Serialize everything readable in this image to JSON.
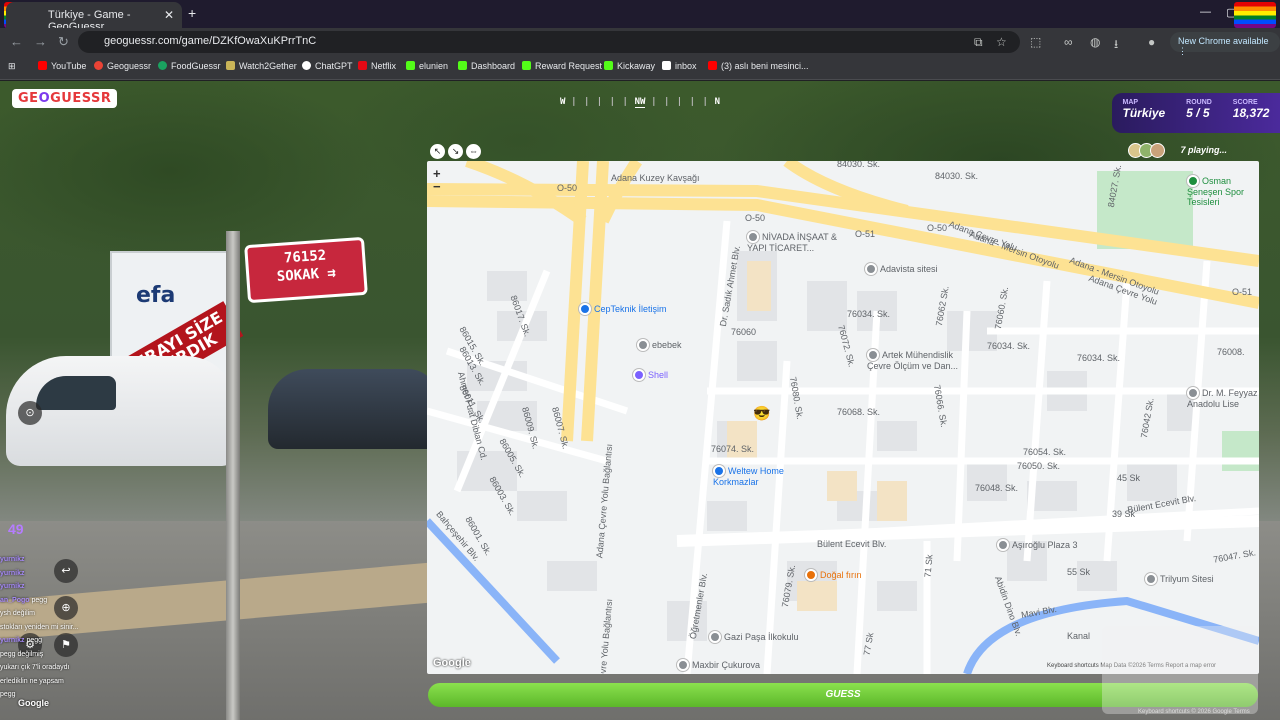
{
  "browser": {
    "tab_title": "Türkiye - Game - GeoGuessr",
    "url": "geoguessr.com/game/DZKfOwaXuKPrrTnC",
    "new_chrome": "New Chrome available",
    "bookmarks": [
      "YouTube",
      "Geoguessr",
      "FoodGuessr",
      "Watch2Gether",
      "ChatGPT",
      "Netflix",
      "elunien",
      "Dashboard",
      "Reward Request",
      "Kickaway",
      "inbox",
      "(3) aslı beni mesinci..."
    ],
    "bookmark_colors": [
      "#ff0000",
      "#ea4335",
      "#1aa260",
      "#c9b458",
      "#ffffff",
      "#e50914",
      "#53fc18",
      "#53fc18",
      "#53fc18",
      "#53fc18",
      "#ffffff",
      "#ff0000"
    ]
  },
  "game": {
    "logo_a": "GE",
    "logo_b": "O",
    "logo_c": "GUESSR",
    "compass_w": "W",
    "compass_nw": "NW",
    "compass_n": "N",
    "hud": {
      "map_label": "MAP",
      "map_value": "Türkiye",
      "round_label": "ROUND",
      "round_value": "5 / 5",
      "score_label": "SCORE",
      "score_value": "18,372"
    },
    "playing": "7 playing...",
    "guess_button": "GUESS",
    "chat_count": "49"
  },
  "scene": {
    "sign_line1": "76152",
    "sign_line2": "SOKAK ⇉",
    "billboard_logo": "efa",
    "banner": "BURAYI SİZE YIKIRDIK"
  },
  "map": {
    "zoom_in": "+",
    "zoom_out": "−",
    "google": "Google",
    "footer": "Keyboard shortcuts   Map Data ©2026   Terms   Report a map error",
    "streets": [
      "Adana Kuzey Kavşağı",
      "84030. Sk.",
      "84030. Sk.",
      "O-50",
      "O-50",
      "O-51",
      "O-50",
      "O-51",
      "Adana Çevre Yolu",
      "Adana - Mersin Otoyolu",
      "Adana - Mersin Otoyolu",
      "Adana Çevre Yolu",
      "86017. Sk.",
      "86015. Sk.",
      "86013. Sk.",
      "86011. Sk.",
      "86009. Sk.",
      "86007. Sk.",
      "86005. Sk.",
      "86003. Sk.",
      "86001. Sk.",
      "Ahmet Fuat Diblan Cd.",
      "Adana Çevre Yolu Bağlantısı",
      "Dr. Sadık Ahmet Blv.",
      "76034. Sk.",
      "76034. Sk.",
      "76034. Sk.",
      "76060",
      "76072. Sk.",
      "76080. Sk.",
      "76066. Sk.",
      "76068. Sk.",
      "76074. Sk.",
      "76050. Sk.",
      "76054. Sk.",
      "76048. Sk.",
      "45 Sk",
      "39 Sk",
      "Bülent Ecevit Blv.",
      "Bülent Ecevit Blv.",
      "76079. Sk.",
      "71 Sk",
      "77 Sk",
      "55 Sk",
      "Abidin Dino Blv.",
      "Mavi Blv.",
      "Öğretmenler Blv.",
      "Bahçeşehir Blv.",
      "Adana Çevre Yolu Bağlantısı",
      "76008.",
      "76042 Sk.",
      "76047. Sk.",
      "84027. Sk.",
      "76060. Sk.",
      "76062 Sk.",
      "Kanal"
    ],
    "pois": [
      {
        "name": "NİVADA İNŞAAT & YAPI TİCARET...",
        "color": "#8a8f94"
      },
      {
        "name": "Adavista sitesi",
        "color": "#8a8f94"
      },
      {
        "name": "CepTeknik İletişim",
        "color": "#1a73e8"
      },
      {
        "name": "ebebek",
        "color": "#8a8f94"
      },
      {
        "name": "Shell",
        "color": "#7b61ff"
      },
      {
        "name": "Artek Mühendislik Çevre Ölçüm ve Dan...",
        "color": "#8a8f94"
      },
      {
        "name": "Osman Şeneşen Spor Tesisleri",
        "color": "#1e8e3e"
      },
      {
        "name": "Weltew Home Korkmazlar",
        "color": "#1a73e8"
      },
      {
        "name": "Dr. M. Feyyaz Anadolu Lise",
        "color": "#8a8f94"
      },
      {
        "name": "Aşıroğlu Plaza 3",
        "color": "#8a8f94"
      },
      {
        "name": "Trilyum Sitesi",
        "color": "#8a8f94"
      },
      {
        "name": "Doğal fırın",
        "color": "#e8710a"
      },
      {
        "name": "Gazi Paşa İlkokulu",
        "color": "#8a8f94"
      },
      {
        "name": "Maxbir Çukurova",
        "color": "#8a8f94"
      }
    ]
  },
  "chat": [
    {
      "user": "yurnikz",
      "msg": ""
    },
    {
      "user": "yurnikz",
      "msg": ""
    },
    {
      "user": "yurnikz",
      "msg": ""
    },
    {
      "user": "an_Pogo",
      "msg": "pegg"
    },
    {
      "user": "",
      "msg": "ysh değilim"
    },
    {
      "user": "",
      "msg": "stokları yeniden mi sinir..."
    },
    {
      "user": "",
      "msg": ""
    },
    {
      "user": "",
      "msg": ""
    },
    {
      "user": "yurnikz",
      "msg": "pegg"
    },
    {
      "user": "",
      "msg": "pegg değilmiş"
    },
    {
      "user": "",
      "msg": "yukarı çık 7'li oradaydı"
    },
    {
      "user": "",
      "msg": "erlediklin ne yapsam"
    },
    {
      "user": "",
      "msg": "pegg"
    }
  ],
  "footer": {
    "google_sv": "Google",
    "keyboard": "Keyboard shortcuts   © 2026 Google   Terms"
  }
}
